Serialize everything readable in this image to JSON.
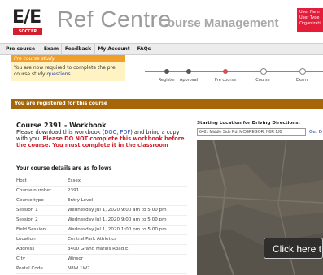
{
  "header": {
    "logo_letters": "E/E",
    "logo_sub": "SOCCER",
    "title": "Ref Centre",
    "subtitle": "Course Management",
    "user_lines": [
      "User Nam",
      "User Type",
      "Organizati"
    ]
  },
  "nav": {
    "tabs": [
      "Pre course study",
      "Exam",
      "Feedback",
      "My Account",
      "FAQs"
    ]
  },
  "notice": {
    "heading": "Pre course study",
    "text_before_link": "You are now required to complete the pre course study ",
    "link": "questions"
  },
  "steps": {
    "labels": [
      "Register",
      "Approval",
      "Pre course",
      "Course",
      "Exam"
    ],
    "colors": {
      "done": "#555555",
      "current": "#d0505a",
      "todo": "#ffffff"
    }
  },
  "registered_bar": "You are registered for this course",
  "course": {
    "title": "Course 2391 - Workbook",
    "instr_1": "Please download this workbook (",
    "link_doc": "DOC",
    "sep": ", ",
    "link_pdf": "PDF",
    "instr_2": ") and bring a copy with you. ",
    "warning": "Please DO NOT complete this workbook before the course. You must complete it in the classroom"
  },
  "details": {
    "heading": "Your course details are as follows",
    "rows": [
      {
        "key": "Host",
        "value": "Essex"
      },
      {
        "key": "Course number",
        "value": "2391"
      },
      {
        "key": "Course type",
        "value": "Entry Level"
      },
      {
        "key": "Session 1",
        "value": "Wednesday Jul 1, 2020 9:00 am to 5:00 pm"
      },
      {
        "key": "Session 2",
        "value": "Wednesday Jul 1, 2020 9:00 am to 5:00 pm"
      },
      {
        "key": "Field Session",
        "value": "Wednesday Jul 1, 2020 1:00 pm to 5:00 pm"
      },
      {
        "key": "Location",
        "value": "Central Park Athletics"
      },
      {
        "key": "Address",
        "value": "3400 Grand Marais Road E"
      },
      {
        "key": "City",
        "value": "Winsor"
      },
      {
        "key": "Postal Code",
        "value": "N8W 1W7"
      }
    ]
  },
  "directions": {
    "label": "Starting Location for Driving Directions:",
    "input_value": "6481 Middle Side Rd, MCGREGOR, N0R 1J0",
    "go_label": "Get D",
    "map_overlay": "Click here t"
  },
  "colors": {
    "brand_red": "#d31f2b",
    "notice_orange": "#f0a02a",
    "bar_brown": "#a5660a",
    "link_blue": "#2040b0"
  }
}
